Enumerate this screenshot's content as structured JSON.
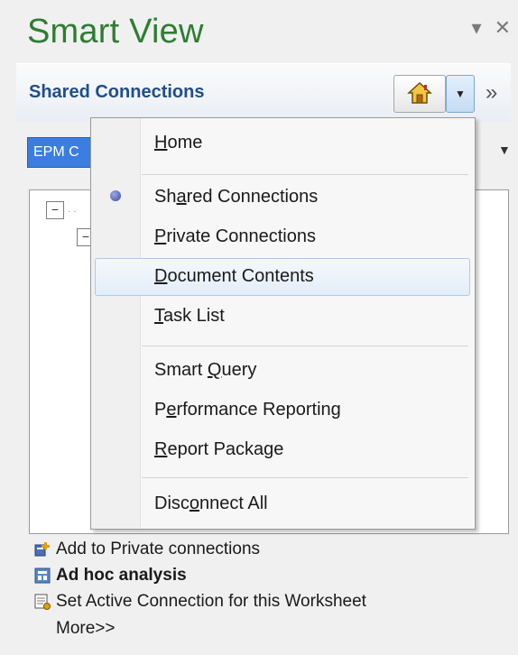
{
  "pane": {
    "title": "Smart View",
    "pin_icon": "pin-dropdown-icon",
    "close_icon": "close-icon"
  },
  "subheader": {
    "title": "Shared Connections",
    "home_icon": "home-icon",
    "dropdown_icon": "chevron-down-icon",
    "more_icon": "double-chevron-right-icon"
  },
  "connection_select": {
    "value": "EPM C"
  },
  "menu": {
    "items": [
      {
        "pre": "",
        "u": "H",
        "post": "ome"
      },
      {
        "pre": "Sh",
        "u": "a",
        "post": "red Connections",
        "selected": true
      },
      {
        "pre": "",
        "u": "P",
        "post": "rivate Connections"
      },
      {
        "pre": "",
        "u": "D",
        "post": "ocument Contents"
      },
      {
        "pre": "",
        "u": "T",
        "post": "ask List"
      },
      {
        "pre": "Smart ",
        "u": "Q",
        "post": "uery"
      },
      {
        "pre": "P",
        "u": "e",
        "post": "rformance Reporting"
      },
      {
        "pre": "",
        "u": "R",
        "post": "eport Package"
      },
      {
        "pre": "Disc",
        "u": "o",
        "post": "nnect All"
      }
    ]
  },
  "actions": [
    {
      "label": "Add to Private connections",
      "icon": "add-connection-icon"
    },
    {
      "label": "Ad hoc analysis",
      "icon": "ad-hoc-icon"
    },
    {
      "label": "Set Active Connection for this Worksheet",
      "icon": "set-active-icon"
    },
    {
      "label": "More>>"
    }
  ],
  "colors": {
    "title_green": "#2e7d32",
    "subheader_blue": "#1f4e8c",
    "selection_blue": "#3b7ee0",
    "hover_border": "#aecae9"
  }
}
